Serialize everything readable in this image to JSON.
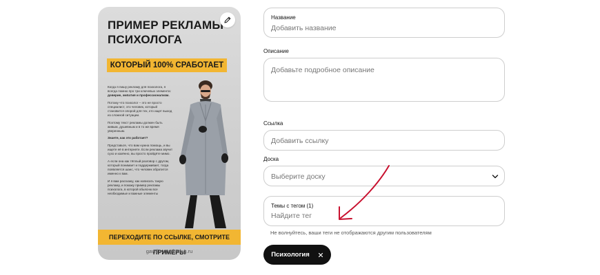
{
  "pin": {
    "title_line1": "ПРИМЕР РЕКЛАМЫ",
    "title_line2": "ПСИХОЛОГА",
    "banner": "КОТОРЫЙ 100% СРАБОТАЕТ",
    "body": {
      "p1": "Когда я пишу рекламу для психолога, я всегда помню про три ключевых элемента:",
      "p1_bold": "доверие, эмпатия и профессионализм.",
      "p2": "Потому что психолог – это не просто специалист, это человек, который становится опорой для тех, кто ищет выход из сложной ситуации.",
      "p3": "Поэтому текст рекламы должен быть живым, душевным и в то же время уверенным.",
      "p4": "Знаете, как это работает?",
      "p5": "Представьте, что вам нужна помощь, и вы ищете её в интернете. Если реклама звучит сухо и казённо, вы просто пройдёте мимо.",
      "p6": "А если она как тёплый разговор с другом, который понимает и поддерживает, тогда появляется шанс, что человек обратится именно к вам.",
      "p7": "И я вам расскажу, как написать такую рекламу, и покажу пример рекламы психолога, в которой обьясню все необходимые и важные элементы"
    },
    "cta": "ПЕРЕХОДИТЕ ПО ССЫЛКЕ, СМОТРИТЕ ПРИМЕРЫ",
    "site": "gavrilovmarketing.ru"
  },
  "form": {
    "title": {
      "label": "Название",
      "placeholder": "Добавить название"
    },
    "description": {
      "label": "Описание",
      "placeholder": "Добавьте подробное описание"
    },
    "link": {
      "label": "Ссылка",
      "placeholder": "Добавить ссылку"
    },
    "board": {
      "label": "Доска",
      "placeholder": "Выберите доску"
    },
    "tags": {
      "label": "Темы с тегом (1)",
      "placeholder": "Найдите тег"
    },
    "hint": "Не волнуйтесь, ваши теги не отображаются другим пользователям",
    "chips": [
      {
        "label": "Психология"
      }
    ]
  },
  "colors": {
    "accent_yellow": "#f2b632",
    "chip_bg": "#111111",
    "annotation_red": "#c8102e",
    "border": "#cdcdcd"
  },
  "icons": [
    "pencil-icon",
    "chevron-down-icon",
    "close-icon"
  ]
}
